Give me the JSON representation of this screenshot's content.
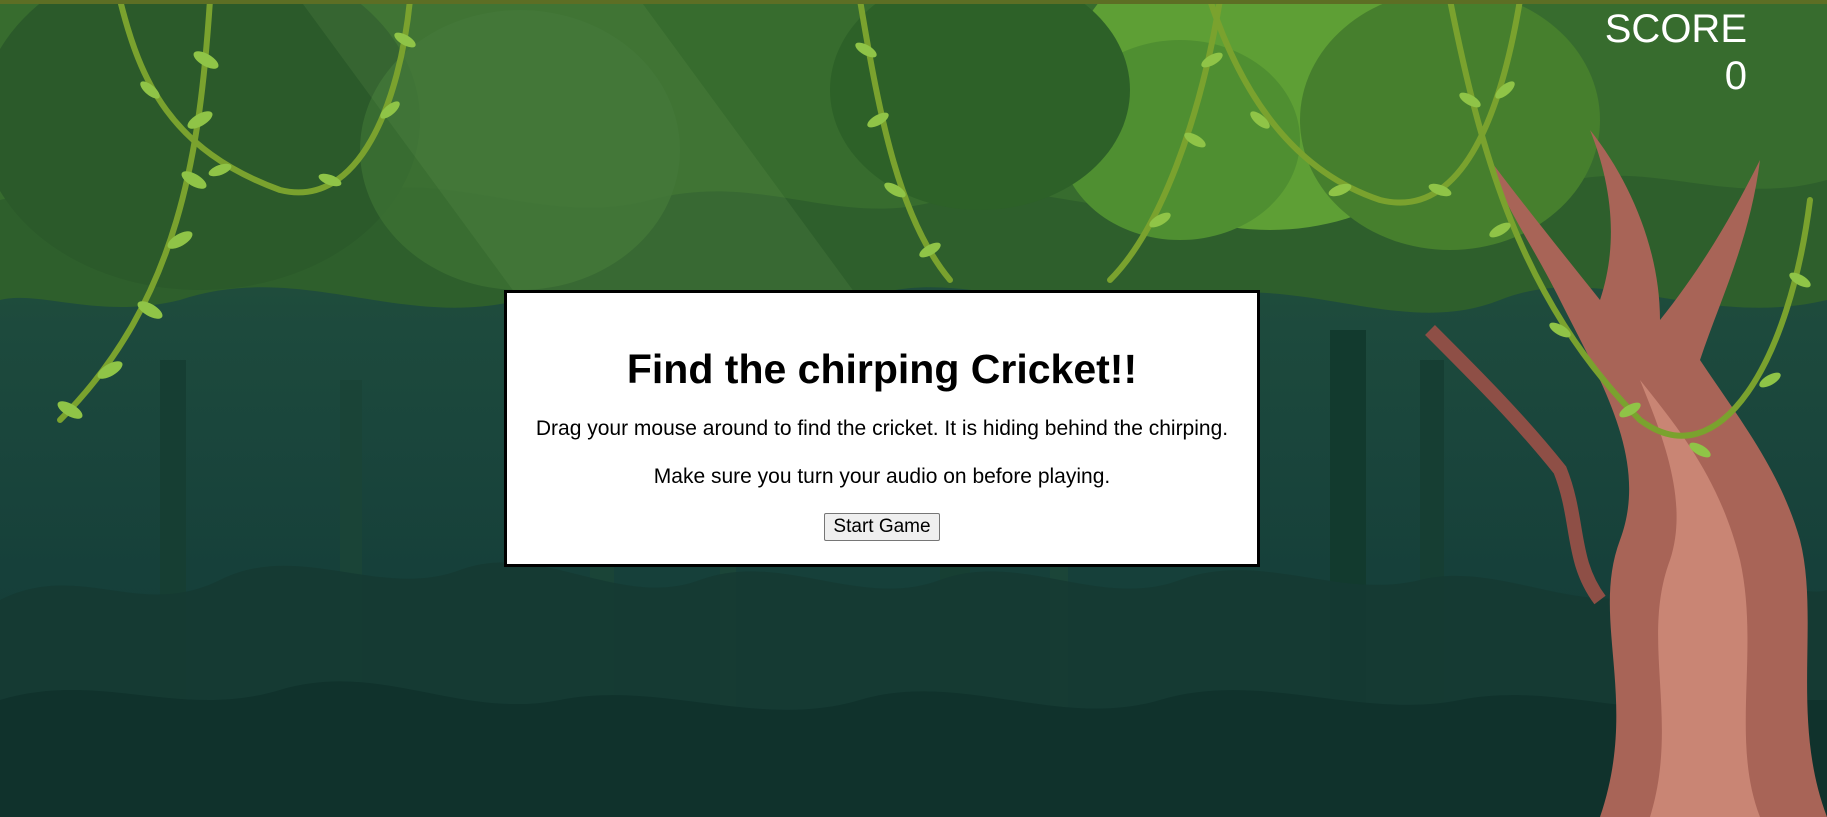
{
  "score": {
    "label": "SCORE",
    "value": "0"
  },
  "modal": {
    "title": "Find the chirping Cricket!!",
    "instruction": "Drag your mouse around to find the cricket. It is hiding behind the chirping.",
    "audio_note": "Make sure you turn your audio on before playing.",
    "start_label": "Start Game"
  },
  "colors": {
    "canopy": "#3f7a2e",
    "leaf_light": "#7cbf3e",
    "vine": "#6e9b2a",
    "trunk_dark": "#123a30",
    "tree_bark": "#b0675a",
    "background_deep": "#16403a"
  }
}
